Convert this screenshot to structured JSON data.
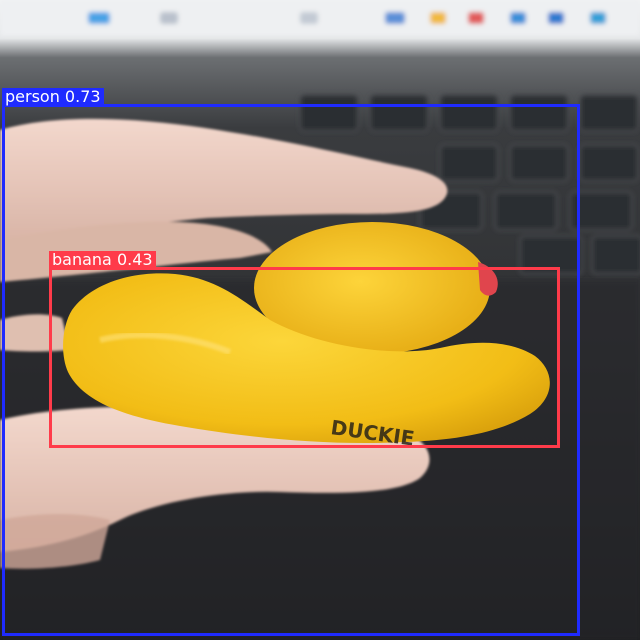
{
  "detections": [
    {
      "label": "person 0.73",
      "class": "person",
      "confidence": 0.73,
      "color": "#1f2bff"
    },
    {
      "label": "banana 0.43",
      "class": "banana",
      "confidence": 0.43,
      "color": "#ff3b4a"
    }
  ],
  "duck": {
    "printed_text": "DUCKIE"
  }
}
